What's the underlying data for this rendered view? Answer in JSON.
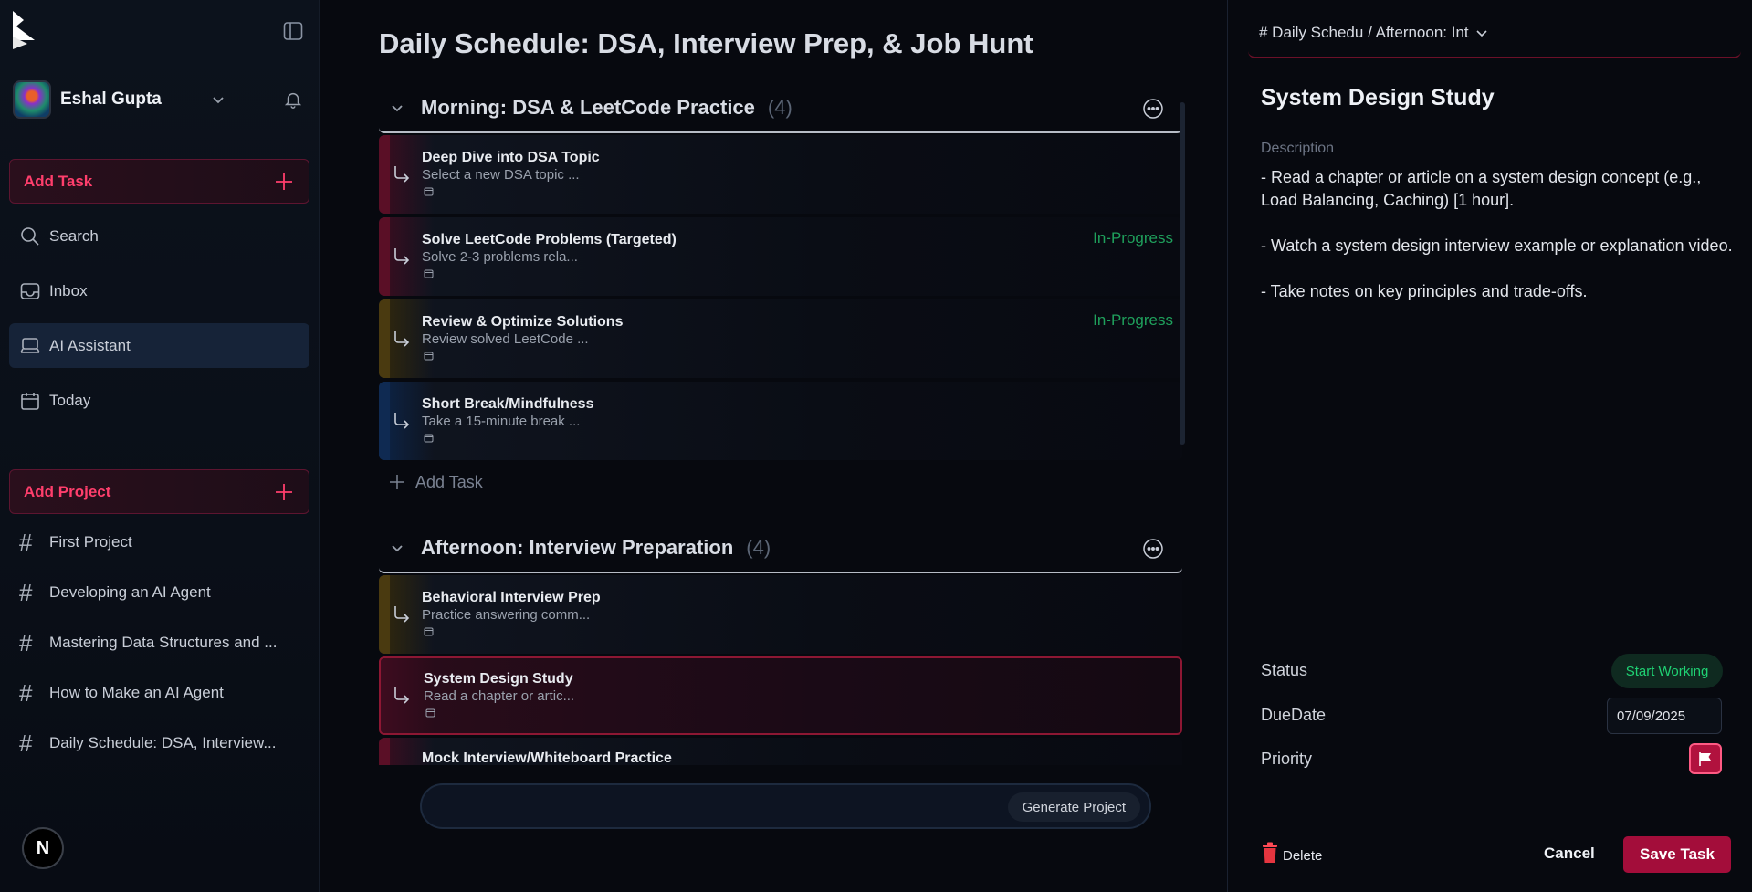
{
  "sidebar": {
    "user_name": "Eshal Gupta",
    "add_task_label": "Add Task",
    "nav": [
      {
        "label": "Search",
        "icon": "search-icon"
      },
      {
        "label": "Inbox",
        "icon": "inbox-icon"
      },
      {
        "label": "AI Assistant",
        "icon": "laptop-icon",
        "active": true
      },
      {
        "label": "Today",
        "icon": "calendar-icon"
      }
    ],
    "add_project_label": "Add Project",
    "projects": [
      {
        "label": "First Project"
      },
      {
        "label": "Developing an AI Agent"
      },
      {
        "label": "Mastering Data Structures and ..."
      },
      {
        "label": "How to Make an AI Agent"
      },
      {
        "label": "Daily Schedule: DSA, Interview..."
      }
    ],
    "footer_badge": "N"
  },
  "main": {
    "title": "Daily Schedule: DSA, Interview Prep, & Job Hunt",
    "sections": [
      {
        "title": "Morning: DSA & LeetCode Practice",
        "count": "(4)",
        "tasks": [
          {
            "title": "Deep Dive into DSA Topic",
            "desc": "Select a new DSA topic ...",
            "status": "",
            "color": "#5a0f26"
          },
          {
            "title": "Solve LeetCode Problems (Targeted)",
            "desc": "Solve 2-3 problems rela...",
            "status": "In-Progress",
            "color": "#5a0f26"
          },
          {
            "title": "Review & Optimize Solutions",
            "desc": "Review solved LeetCode ...",
            "status": "In-Progress",
            "color": "#4a3a10"
          },
          {
            "title": "Short Break/Mindfulness",
            "desc": "Take a 15-minute break ...",
            "status": "",
            "color": "#0f2a52"
          }
        ],
        "add_task_label": "Add Task"
      },
      {
        "title": "Afternoon: Interview Preparation",
        "count": "(4)",
        "tasks": [
          {
            "title": "Behavioral Interview Prep",
            "desc": "Practice answering comm...",
            "status": "",
            "color": "#4a3a10"
          },
          {
            "title": "System Design Study",
            "desc": "Read a chapter or artic...",
            "status": "",
            "color": "#5a0f26",
            "selected": true
          },
          {
            "title": "Mock Interview/Whiteboard Practice",
            "desc": "",
            "status": "",
            "color": "#5a0f26"
          }
        ]
      }
    ],
    "generate_label": "Generate Project"
  },
  "detail": {
    "breadcrumb": "# Daily Schedu / Afternoon: Int",
    "title": "System Design Study",
    "description_label": "Description",
    "description": [
      "- Read a chapter or article on a system design concept (e.g., Load Balancing, Caching) [1 hour].",
      "- Watch a system design interview example or explanation video.",
      "- Take notes on key principles and trade-offs."
    ],
    "status_label": "Status",
    "status_value": "Start Working",
    "due_label": "DueDate",
    "due_value": "07/09/2025",
    "priority_label": "Priority",
    "delete_label": "Delete",
    "cancel_label": "Cancel",
    "save_label": "Save Task"
  },
  "colors": {
    "accent": "#ff3e6c",
    "save": "#a30d3a",
    "status_green": "#1fa05c"
  }
}
